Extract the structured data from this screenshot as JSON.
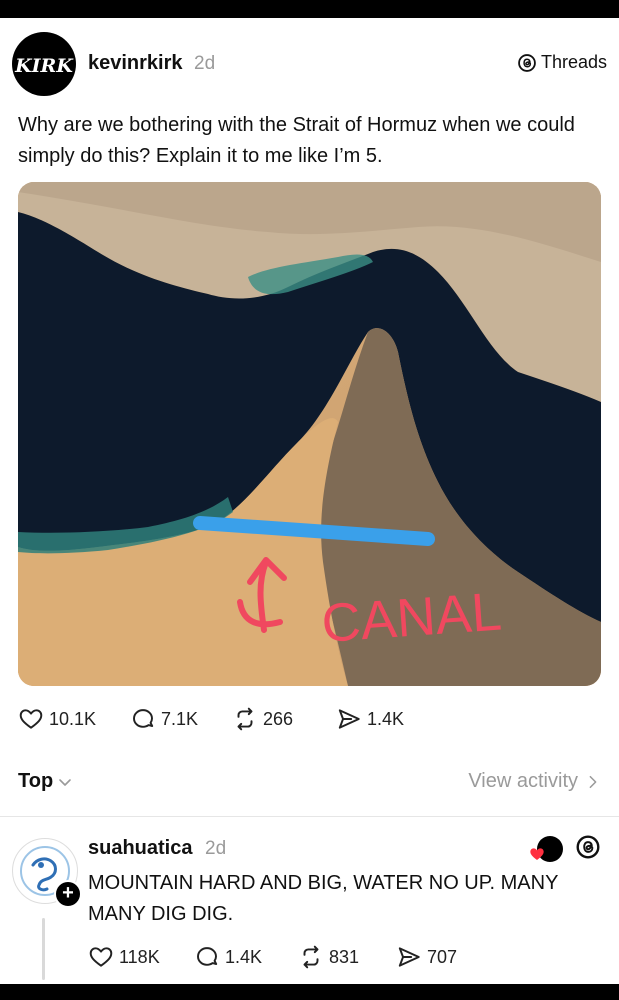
{
  "post": {
    "username": "kevinrkirk",
    "time": "2d",
    "avatar_logo_text": "KIRK",
    "threads_label": "Threads",
    "text": "Why are we bothering with the Strait of Hormuz when we could simply do this? Explain it to me like I’m 5.",
    "image": {
      "annotation_text": "CANAL",
      "line_color": "#3aa0ea",
      "annotation_color": "#f0485f",
      "icon": "satellite-map"
    },
    "stats": {
      "likes": "10.1K",
      "replies": "7.1K",
      "reposts": "266",
      "shares": "1.4K"
    }
  },
  "sort": {
    "label": "Top",
    "view_activity": "View activity"
  },
  "reply": {
    "username": "suahuatica",
    "time": "2d",
    "text": "MOUNTAIN HARD AND BIG, WATER NO UP. MANY MANY DIG DIG.",
    "follow_symbol": "+",
    "stats": {
      "likes": "118K",
      "replies": "1.4K",
      "reposts": "831",
      "shares": "707"
    }
  },
  "colors": {
    "heart_liked": "#ff3040",
    "muted_text": "#9a9a9a"
  }
}
